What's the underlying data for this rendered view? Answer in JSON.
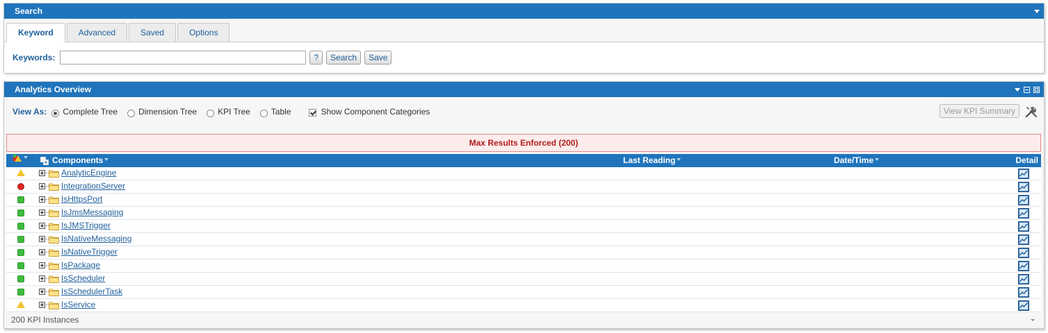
{
  "search": {
    "title": "Search",
    "tabs": [
      "Keyword",
      "Advanced",
      "Saved",
      "Options"
    ],
    "active_tab": "Keyword",
    "keywords_label": "Keywords:",
    "keywords_value": "",
    "help_label": "?",
    "search_label": "Search",
    "save_label": "Save"
  },
  "analytics": {
    "title": "Analytics Overview",
    "view_as_label": "View As:",
    "view_options": [
      "Complete Tree",
      "Dimension Tree",
      "KPI Tree",
      "Table"
    ],
    "selected_view": "Complete Tree",
    "show_categories_label": "Show Component Categories",
    "show_categories_checked": true,
    "view_kpi_summary_label": "View KPI Summary",
    "max_results_text": "Max Results Enforced (200)",
    "columns": {
      "components": "Components",
      "last_reading": "Last Reading",
      "datetime": "Date/Time",
      "detail": "Detail"
    },
    "rows": [
      {
        "name": "AnalyticEngine",
        "status": "warning"
      },
      {
        "name": "IntegrationServer",
        "status": "critical"
      },
      {
        "name": "IsHttpsPort",
        "status": "ok"
      },
      {
        "name": "IsJmsMessaging",
        "status": "ok"
      },
      {
        "name": "IsJMSTrigger",
        "status": "ok"
      },
      {
        "name": "IsNativeMessaging",
        "status": "ok"
      },
      {
        "name": "IsNativeTrigger",
        "status": "ok"
      },
      {
        "name": "IsPackage",
        "status": "ok"
      },
      {
        "name": "IsScheduler",
        "status": "ok"
      },
      {
        "name": "IsSchedulerTask",
        "status": "ok"
      },
      {
        "name": "IsService",
        "status": "warning"
      }
    ],
    "footer_text": "200 KPI Instances"
  },
  "colors": {
    "header_blue": "#1f74bc",
    "link_blue": "#1f5f9b",
    "ok_green": "#3ebc3e",
    "critical_red": "#e02424",
    "warning_yellow": "#f2c12b",
    "banner_red": "#b11c1c"
  }
}
